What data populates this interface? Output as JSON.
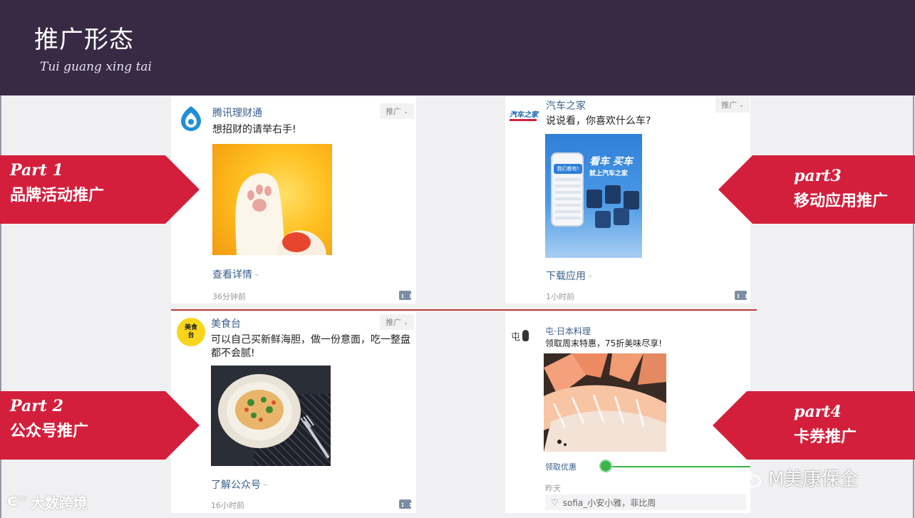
{
  "header": {
    "title": "推广形态",
    "subtitle": "Tui guang xing tai"
  },
  "badges": [
    {
      "en": "Part 1",
      "zh": "品牌活动推广"
    },
    {
      "en": "Part 2",
      "zh": "公众号推广"
    },
    {
      "en": "part3",
      "zh": "移动应用推广"
    },
    {
      "en": "part4",
      "zh": "卡券推广"
    }
  ],
  "cards": {
    "brand": {
      "account": "腾讯理财通",
      "caption": "想招财的请举右手!",
      "promo_tag": "推广",
      "link": "查看详情",
      "time": "36分钟前"
    },
    "app": {
      "account": "汽车之家",
      "caption": "说说看，你喜欢什么车?",
      "promo_tag": "推广",
      "logo_text": "汽车之家",
      "slogan_line1": "看车 买车",
      "slogan_line2": "就上汽车之家",
      "bubble": "我们都有!",
      "link": "下载应用",
      "time": "1小时前"
    },
    "official": {
      "account": "美食台",
      "avatar_text": "美食台",
      "caption": "可以自己买新鲜海胆，做一份意面，吃一整盘都不会腻!",
      "promo_tag": "推广",
      "link": "了解公众号",
      "time": "16小时前"
    },
    "coupon": {
      "account": "屯·日本料理",
      "avatar_text": "屯",
      "caption": "领取周末特惠，75折美味尽享!",
      "coupon_label": "领取优惠",
      "time": "昨天",
      "comment": "sofia_小安小雅，菲比周"
    }
  },
  "watermarks": {
    "left": "大数跨境",
    "right": "M美康保全"
  },
  "colors": {
    "header_bg": "#382a45",
    "badge_red": "#d41f3c",
    "link_blue": "#3a5e8c"
  }
}
